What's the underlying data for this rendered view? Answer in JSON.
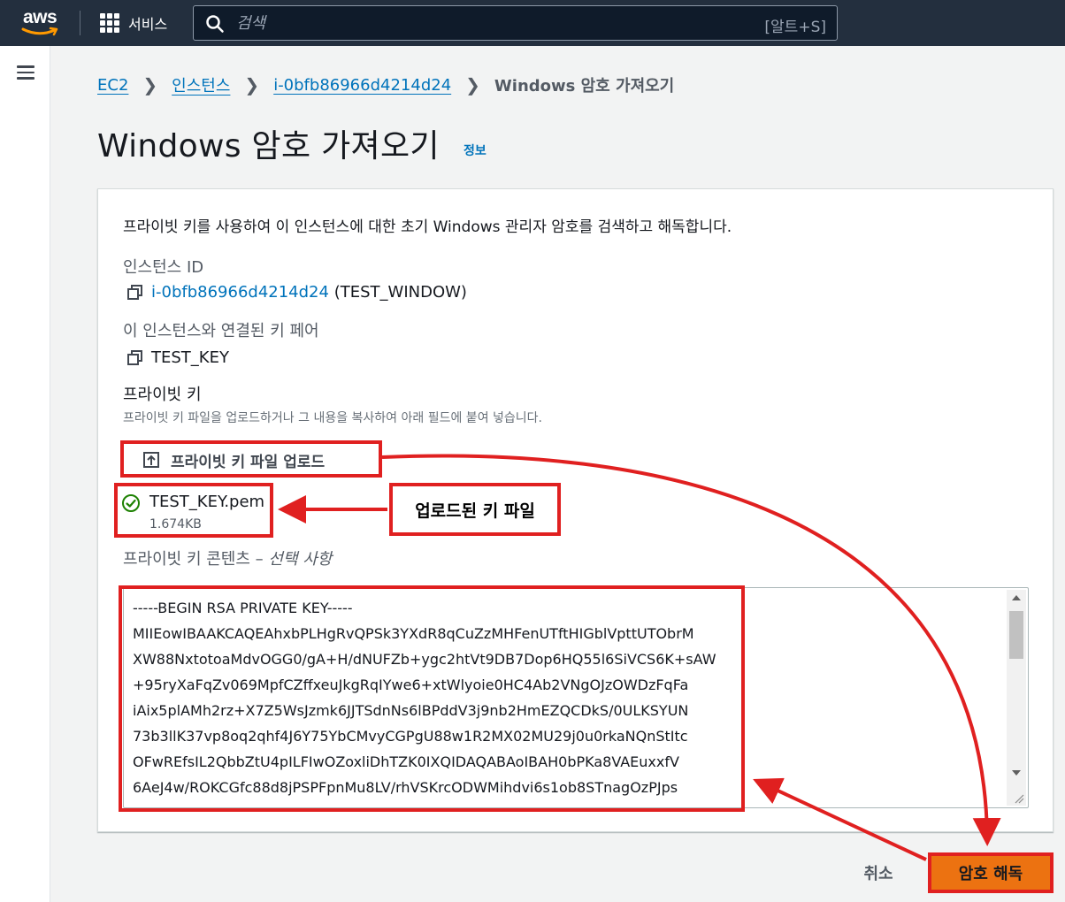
{
  "topnav": {
    "logo_text": "aws",
    "services_label": "서비스",
    "search_placeholder": "검색",
    "search_shortcut": "[알트+S]"
  },
  "breadcrumb": {
    "items": [
      "EC2",
      "인스턴스",
      "i-0bfb86966d4214d24"
    ],
    "current": "Windows 암호 가져오기"
  },
  "page": {
    "title": "Windows 암호 가져오기",
    "info_link": "정보"
  },
  "panel": {
    "description": "프라이빗 키를 사용하여 이 인스턴스에 대한 초기 Windows 관리자 암호를 검색하고 해독합니다.",
    "instance_id_label": "인스턴스 ID",
    "instance_id": "i-0bfb86966d4214d24",
    "instance_name": "(TEST_WINDOW)",
    "key_pair_label": "이 인스턴스와 연결된 키 페어",
    "key_pair": "TEST_KEY",
    "private_key_label": "프라이빗 키",
    "private_key_hint": "프라이빗 키 파일을 업로드하거나 그 내용을 복사하여 아래 필드에 붙여 넣습니다.",
    "upload_button": "프라이빗 키 파일 업로드",
    "uploaded_file": {
      "name": "TEST_KEY.pem",
      "size": "1.674KB"
    },
    "content_label": "프라이빗 키 콘텐츠 –",
    "content_optional": "선택 사항",
    "key_content_lines": [
      "-----BEGIN RSA PRIVATE KEY-----",
      "MIIEowIBAAKCAQEAhxbPLHgRvQPSk3YXdR8qCuZzMHFenUTftHIGblVpttUTObrM",
      "XW88NxtotoaMdvOGG0/gA+H/dNUFZb+ygc2htVt9DB7Dop6HQ55l6SiVCS6K+sAW",
      "+95ryXaFqZv069MpfCZffxeuJkgRqIYwe6+xtWlyoie0HC4Ab2VNgOJzOWDzFqFa",
      "iAix5plAMh2rz+X7Z5WsJzmk6JJTSdnNs6lBPddV3j9nb2HmEZQCDkS/0ULKSYUN",
      "73b3llK37vp8oq2qhf4J6Y75YbCMvyCGPgU88w1R2MX02MU29j0u0rkaNQnStItc",
      "OFwREfsIL2QbbZtU4pILFIwOZoxliDhTZK0IXQIDAQABAoIBAH0bPKa8VAEuxxfV",
      "6AeJ4w/ROKCGfc88d8jPSPFpnMu8LV/rhVSKrcODWMihdvi6s1ob8STnagOzPJps"
    ]
  },
  "footer": {
    "cancel": "취소",
    "decrypt": "암호 해독"
  },
  "annotation": {
    "callout": "업로드된 키 파일"
  },
  "colors": {
    "nav_bg": "#232f3e",
    "link": "#0073bb",
    "primary_button": "#ec7211",
    "annotation_red": "#e02020",
    "success_green": "#1d8102"
  }
}
